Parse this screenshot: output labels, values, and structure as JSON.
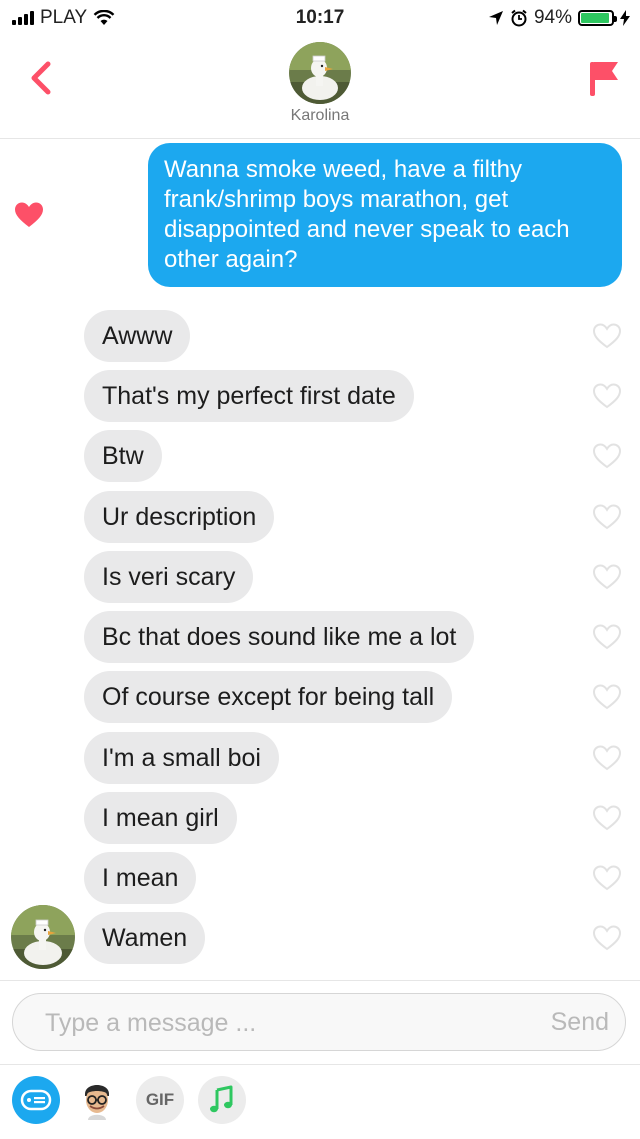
{
  "status_bar": {
    "carrier": "PLAY",
    "time": "10:17",
    "battery": "94%",
    "battery_level": 0.94
  },
  "header": {
    "match_name": "Karolina",
    "back_icon": "chevron-left-icon",
    "report_icon": "flag-icon"
  },
  "conversation": {
    "sent": "Wanna smoke weed, have a filthy frank/shrimp boys marathon, get disappointed and never speak to each other again?",
    "sent_liked": true,
    "received": [
      "Awww",
      "That's my perfect first date",
      "Btw",
      "Ur description",
      "Is veri scary",
      "Bc that does sound like me a lot",
      "Of course except for being tall",
      "I'm a small boi",
      "I mean girl",
      "I mean",
      "Wamen"
    ]
  },
  "composer": {
    "placeholder": "Type a message ...",
    "send_label": "Send"
  },
  "toolbar": {
    "gif_label": "GIF",
    "items": [
      "sticker-icon",
      "bitmoji-avatar",
      "gif-button",
      "music-icon"
    ]
  },
  "colors": {
    "accent": "#fd5068",
    "sent_bubble": "#1ca8ef",
    "received_bubble": "#e9e9ea",
    "music": "#2ec760",
    "sticker": "#1ca8ef"
  }
}
